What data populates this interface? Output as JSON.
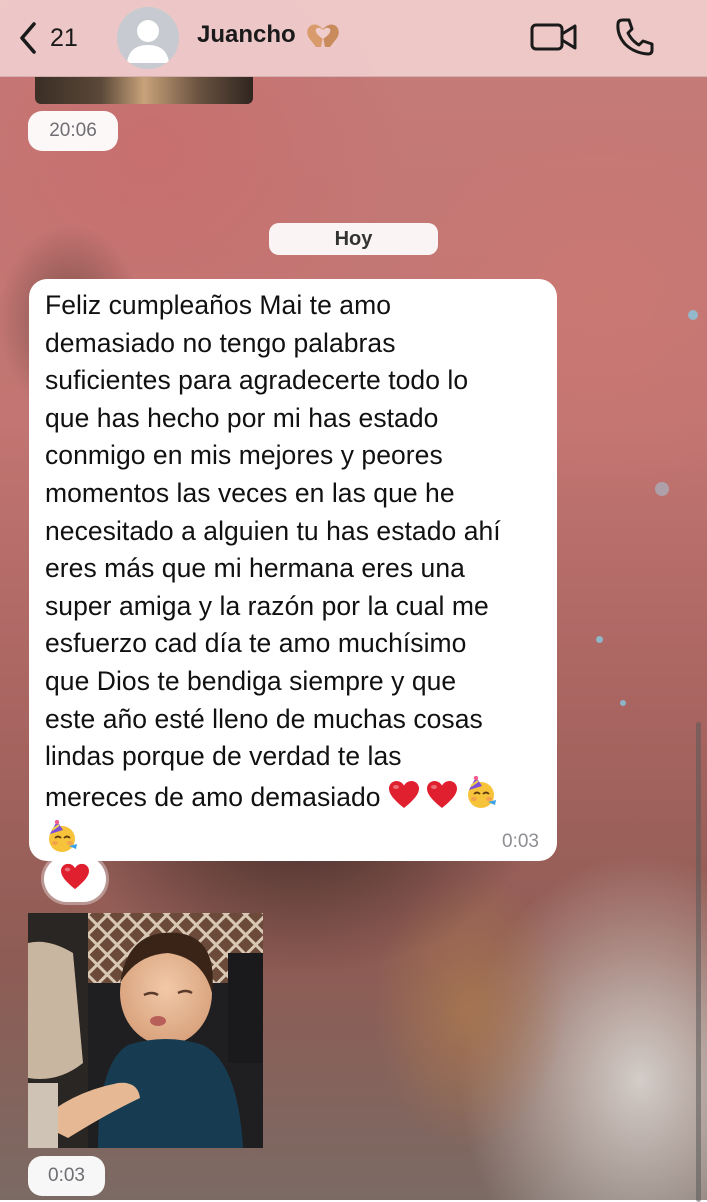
{
  "header": {
    "back_count": "21",
    "contact_name": "Juancho"
  },
  "earlier": {
    "time": "20:06"
  },
  "date_separator": "Hoy",
  "message": {
    "lines": [
      "Feliz cumpleaños Mai te amo",
      "demasiado no tengo palabras",
      "suficientes para agradecerte todo lo",
      "que has hecho por mi has estado",
      "conmigo en mis mejores y peores",
      "momentos las veces en las que he",
      "necesitado a alguien tu has estado ahí",
      "eres más que mi hermana eres una",
      "super amiga y la razón por la cual me",
      "esfuerzo cad día te amo muchísimo",
      "que Dios te bendiga siempre y que",
      "este año esté lleno de muchas cosas",
      "lindas porque de verdad te las",
      "mereces de amo demasiado"
    ],
    "time": "0:03",
    "trailing_emojis": [
      "red-heart",
      "red-heart",
      "partying-face",
      "partying-face"
    ],
    "reaction": "red-heart"
  },
  "photo_message": {
    "time": "0:03"
  },
  "colors": {
    "header_bg": "#f0cdcd",
    "bubble_bg": "#ffffff",
    "heart": "#e0202e",
    "partying_face": "#f7c33a"
  }
}
